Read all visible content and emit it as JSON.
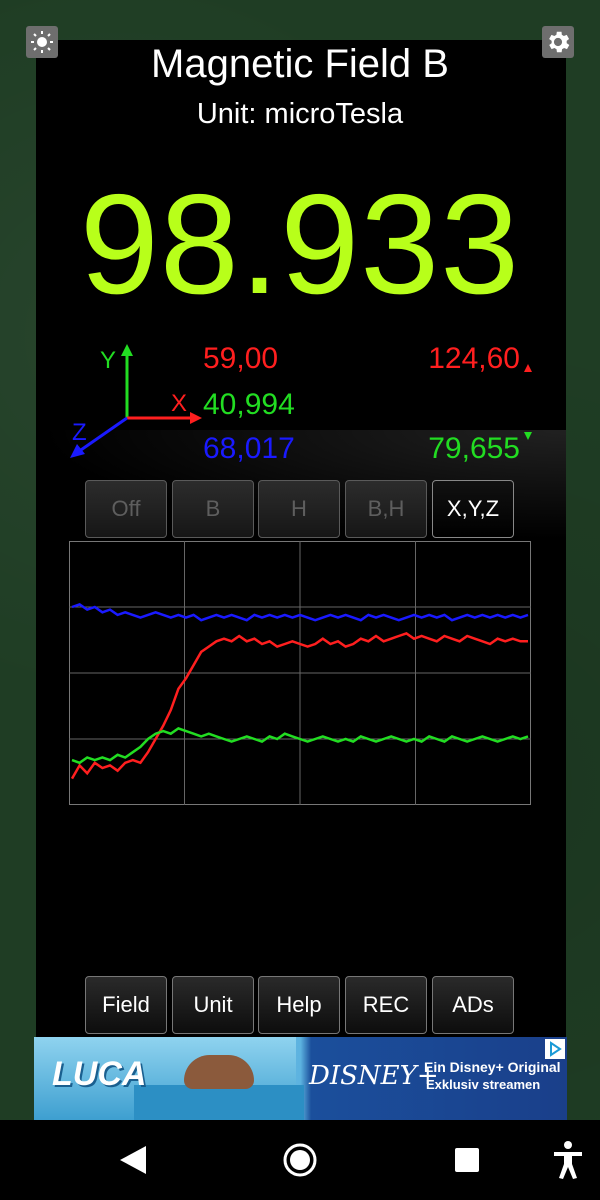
{
  "header": {
    "title": "Magnetic Field B",
    "subtitle": "Unit: microTesla"
  },
  "reading": {
    "magnitude": "98.933"
  },
  "axes_labels": {
    "x": "X",
    "y": "Y",
    "z": "Z"
  },
  "components": {
    "x": "59,00",
    "y": "40,994",
    "z": "68,017"
  },
  "range": {
    "max": "124,60",
    "min": "79,655"
  },
  "mode_buttons": [
    {
      "label": "Off",
      "active": false
    },
    {
      "label": "B",
      "active": false
    },
    {
      "label": "H",
      "active": false
    },
    {
      "label": "B,H",
      "active": false
    },
    {
      "label": "X,Y,Z",
      "active": true
    }
  ],
  "bottom_buttons": [
    "Field",
    "Unit",
    "Help",
    "REC",
    "ADs"
  ],
  "ad": {
    "brand_left": "LUCA",
    "brand_right": "DISNEY+",
    "line1": "Ein Disney+ Original",
    "line2": "Exklusiv streamen"
  },
  "colors": {
    "value_green": "#b8ff1a",
    "x_red": "#ff1f1f",
    "y_green": "#22dd22",
    "z_blue": "#1a1aff"
  },
  "icons": {
    "top_left": "brightness-icon",
    "top_right": "gear-icon",
    "nav": [
      "back-icon",
      "home-icon",
      "recents-icon",
      "accessibility-icon"
    ]
  },
  "chart_data": {
    "type": "line",
    "grid": true,
    "series": [
      {
        "color": "#1a1aff",
        "values": [
          0.75,
          0.76,
          0.74,
          0.75,
          0.73,
          0.74,
          0.72,
          0.73,
          0.72,
          0.71,
          0.72,
          0.73,
          0.72,
          0.71,
          0.72,
          0.71,
          0.72,
          0.7,
          0.71,
          0.72,
          0.71,
          0.72,
          0.71,
          0.7,
          0.72,
          0.71,
          0.72,
          0.71,
          0.72,
          0.71,
          0.72,
          0.71,
          0.7,
          0.71,
          0.72,
          0.71,
          0.72,
          0.71,
          0.7,
          0.72,
          0.71,
          0.72,
          0.71,
          0.7,
          0.71,
          0.72,
          0.71,
          0.72,
          0.71,
          0.72,
          0.7,
          0.71,
          0.72,
          0.71,
          0.72,
          0.71,
          0.72,
          0.71,
          0.72,
          0.71,
          0.72
        ]
      },
      {
        "color": "#ff1f1f",
        "values": [
          0.1,
          0.15,
          0.12,
          0.16,
          0.14,
          0.15,
          0.13,
          0.16,
          0.17,
          0.16,
          0.2,
          0.25,
          0.3,
          0.36,
          0.44,
          0.48,
          0.53,
          0.58,
          0.6,
          0.62,
          0.63,
          0.62,
          0.64,
          0.62,
          0.63,
          0.61,
          0.62,
          0.6,
          0.61,
          0.62,
          0.61,
          0.6,
          0.61,
          0.63,
          0.61,
          0.62,
          0.6,
          0.61,
          0.63,
          0.62,
          0.64,
          0.62,
          0.63,
          0.64,
          0.65,
          0.63,
          0.64,
          0.63,
          0.62,
          0.64,
          0.63,
          0.62,
          0.64,
          0.63,
          0.62,
          0.61,
          0.63,
          0.62,
          0.63,
          0.62,
          0.62
        ]
      },
      {
        "color": "#22dd22",
        "values": [
          0.17,
          0.16,
          0.18,
          0.17,
          0.18,
          0.17,
          0.19,
          0.18,
          0.2,
          0.22,
          0.25,
          0.27,
          0.28,
          0.27,
          0.29,
          0.28,
          0.27,
          0.26,
          0.27,
          0.26,
          0.25,
          0.24,
          0.25,
          0.26,
          0.25,
          0.24,
          0.26,
          0.25,
          0.27,
          0.26,
          0.25,
          0.24,
          0.25,
          0.26,
          0.25,
          0.24,
          0.25,
          0.24,
          0.26,
          0.25,
          0.24,
          0.25,
          0.26,
          0.25,
          0.24,
          0.25,
          0.24,
          0.26,
          0.25,
          0.24,
          0.26,
          0.25,
          0.24,
          0.25,
          0.26,
          0.25,
          0.24,
          0.25,
          0.26,
          0.25,
          0.26
        ]
      }
    ],
    "ylim": [
      0,
      1
    ]
  }
}
